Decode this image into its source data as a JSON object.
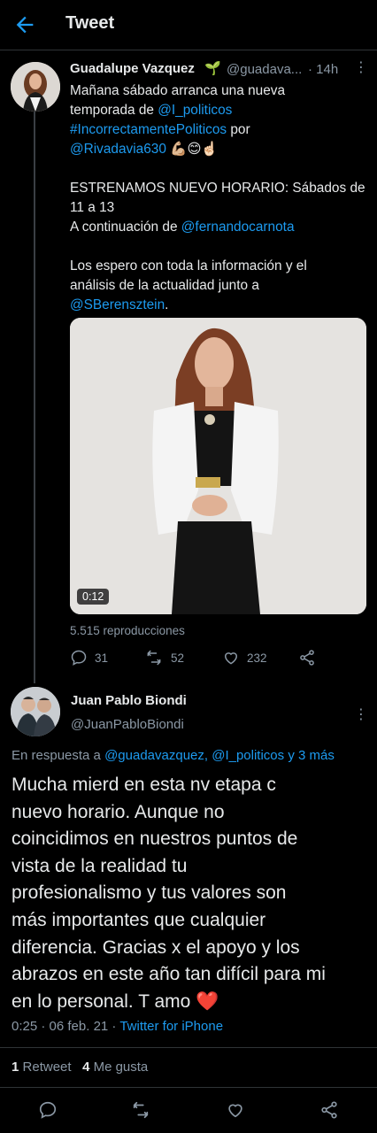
{
  "header": {
    "title": "Tweet"
  },
  "tweet1": {
    "name": "Guadalupe Vazquez",
    "name_emoji": "🌱",
    "handle": "@guadava...",
    "time": "· 14h",
    "more": "⋮",
    "lines": {
      "l1": "Mañana sábado arranca una nueva",
      "l2_pre": "temporada de ",
      "l2_link": "@I_politicos",
      "l3_link": "#IncorrectamentePoliticos",
      "l3_post": " por",
      "l4_link": "@Rivadavia630",
      "l4_emoji": " 💪🏼😊☝🏻",
      "l5": "ESTRENAMOS NUEVO HORARIO: Sábados de",
      "l6": "11 a 13",
      "l7_pre": "A continuación de ",
      "l7_link": "@fernandocarnota",
      "l8": "Los espero con toda la información y el",
      "l9": "análisis de la actualidad junto a",
      "l10_link": "@SBerensztein",
      "l10_post": "."
    },
    "video_duration": "0:12",
    "views": "5.515 reproducciones",
    "replies": "31",
    "retweets": "52",
    "likes": "232"
  },
  "tweet2": {
    "name": "Juan Pablo Biondi",
    "handle": "@JuanPabloBiondi",
    "more": "⋮",
    "reply_prefix": "En respuesta a ",
    "reply_handles": "@guadavazquez, @I_politicos y 3 más",
    "lines": {
      "l1": "Mucha mierd en esta nv etapa c",
      "l2": "nuevo horario. Aunque no",
      "l3": "coincidimos en nuestros puntos de",
      "l4": "vista de la realidad tu",
      "l5": "profesionalismo y tus valores son",
      "l6": "más importantes que cualquier",
      "l7": "diferencia. Gracias x el apoyo y los",
      "l8": "abrazos en este año tan difícil para mi",
      "l9": "en lo personal. T amo",
      "l9_emoji": "❤️"
    },
    "timestamp": "0:25 · 06 feb. 21 · ",
    "client": "Twitter for iPhone",
    "retweet_count": "1",
    "retweet_label": "Retweet",
    "like_count": "4",
    "like_label": "Me gusta"
  },
  "colors": {
    "accent": "#1d9bf0",
    "background": "#000000",
    "secondary_text": "#8b98a5",
    "like_heart": "#f91880"
  },
  "icons": [
    "back-arrow-icon",
    "sprout-icon",
    "more-icon",
    "reply-icon",
    "retweet-icon",
    "like-icon",
    "share-icon"
  ]
}
